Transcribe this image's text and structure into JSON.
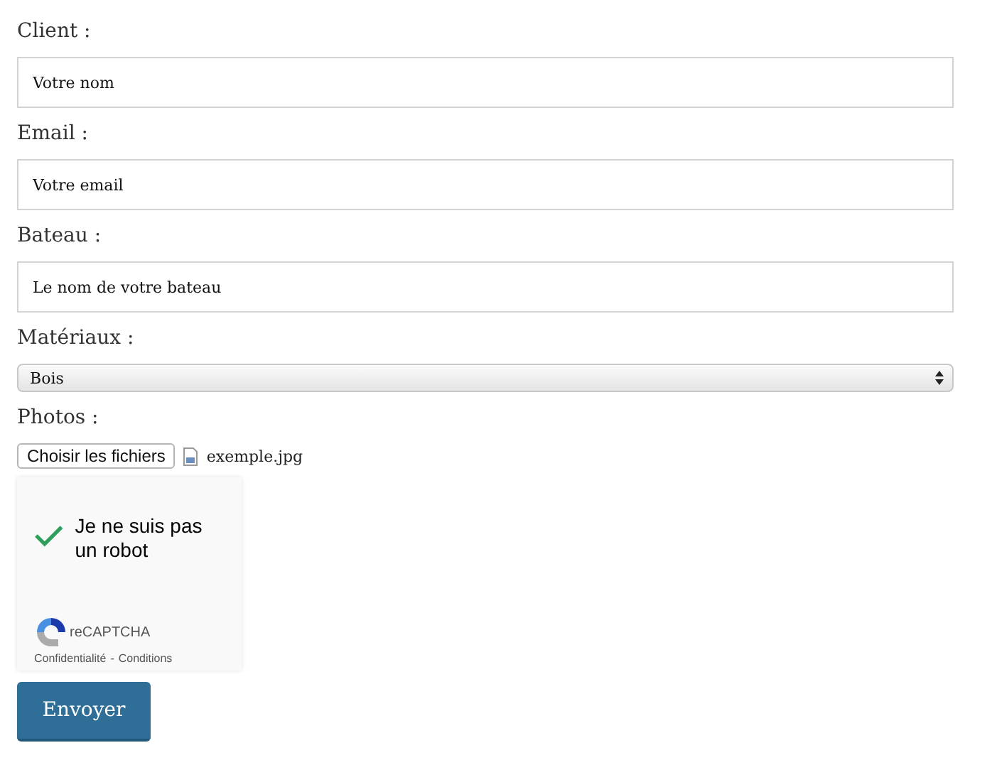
{
  "fields": [
    {
      "kind": "text",
      "label": "Client :",
      "placeholder": "Votre nom"
    },
    {
      "kind": "text",
      "label": "Email :",
      "placeholder": "Votre email"
    },
    {
      "kind": "text",
      "label": "Bateau :",
      "placeholder": "Le nom de votre bateau"
    },
    {
      "kind": "select",
      "label": "Matériaux :",
      "value": "Bois"
    },
    {
      "kind": "file",
      "label": "Photos :",
      "button": "Choisir les fichiers",
      "file": "exemple.jpg"
    }
  ],
  "captcha": {
    "checked": true,
    "text": "Je ne suis pas un robot",
    "brand": "reCAPTCHA",
    "privacy": "Confidentialité",
    "separator": "-",
    "terms": "Conditions"
  },
  "submit": "Envoyer"
}
